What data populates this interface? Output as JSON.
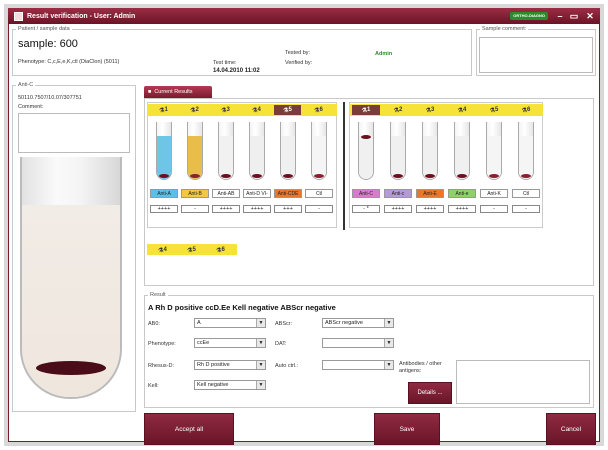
{
  "window": {
    "title": "Result verification - User: Admin",
    "brand": "ORTHO-DIAGNO"
  },
  "patient": {
    "legend": "Patient / sample data",
    "sample": "sample: 600",
    "phenotype": "Phenotype: C,c,E,e,K,ctl (DiaClon) (5011)",
    "tested_by_label": "Tested by:",
    "tested_by": "Admin",
    "test_time_label": "Test time:",
    "test_time": "14.04.2010 11:02",
    "verified_by_label": "Verified by:"
  },
  "sample_comment": {
    "legend": "Sample comment:"
  },
  "anti_c": {
    "legend": "Anti-C",
    "code": "50110.7507/10.07/307751",
    "comment_label": "Comment:"
  },
  "current_results_tab": "Current Results",
  "card1": {
    "tabs": [
      "1",
      "2",
      "3",
      "4",
      "5",
      "6"
    ],
    "tubes": [
      {
        "reagent": "Anti-A",
        "result": "++++",
        "badge_color": "#5bc0e8",
        "liquid_color": "#6ec6e6"
      },
      {
        "reagent": "Anti-B",
        "result": "-",
        "badge_color": "#f2c744",
        "liquid_color": "#e8bd4a"
      },
      {
        "reagent": "Anti-AB",
        "result": "++++",
        "badge_color": "#ffffff",
        "liquid_color": "#f1f1f1"
      },
      {
        "reagent": "Anti-D VI-",
        "result": "++++",
        "badge_color": "#ffffff",
        "liquid_color": "#efefef"
      },
      {
        "reagent": "Anti-CDE",
        "result": "+++",
        "badge_color": "#e8772e",
        "liquid_color": "#f0f0f0"
      },
      {
        "reagent": "Ctl",
        "result": "-",
        "badge_color": "#ffffff",
        "liquid_color": "#f5f5f5"
      }
    ]
  },
  "card2": {
    "tabs": [
      "1",
      "2",
      "3",
      "4",
      "5",
      "6"
    ],
    "tubes": [
      {
        "reagent": "Anti-C",
        "result": "- *",
        "badge_color": "#d77bd0",
        "liquid_color": "#f0f0f0"
      },
      {
        "reagent": "Anti-c",
        "result": "++++",
        "badge_color": "#b59ad8",
        "liquid_color": "#f0f0f0"
      },
      {
        "reagent": "Anti-E",
        "result": "++++",
        "badge_color": "#e8772e",
        "liquid_color": "#f0f0f0"
      },
      {
        "reagent": "Anti-e",
        "result": "++++",
        "badge_color": "#8fd06a",
        "liquid_color": "#f0f0f0"
      },
      {
        "reagent": "Anti-K",
        "result": "-",
        "badge_color": "#ffffff",
        "liquid_color": "#f5f5f5"
      },
      {
        "reagent": "Ctl",
        "result": "-",
        "badge_color": "#ffffff",
        "liquid_color": "#f5f5f5"
      }
    ]
  },
  "card3": {
    "tabs": [
      "4",
      "5",
      "6"
    ]
  },
  "result": {
    "legend": "Result",
    "summary": "A Rh D positive ccD.Ee Kell negative ABScr negative",
    "abo_label": "AB0:",
    "abo_value": "A",
    "phenotype_label": "Phenotype:",
    "phenotype_value": "ccEe",
    "rhesus_label": "Rhesus-D:",
    "rhesus_value": "Rh D positive",
    "kell_label": "Kell:",
    "kell_value": "Kell negative",
    "abscr_label": "ABScr:",
    "abscr_value": "ABScr negative",
    "dat_label": "DAT:",
    "dat_value": "",
    "autoctrl_label": "Auto ctrl.:",
    "autoctrl_value": "",
    "antibodies_label": "Antibodies / other antigens:",
    "details_button": "Details ..."
  },
  "buttons": {
    "accept_all": "Accept all",
    "save": "Save",
    "cancel": "Cancel"
  }
}
